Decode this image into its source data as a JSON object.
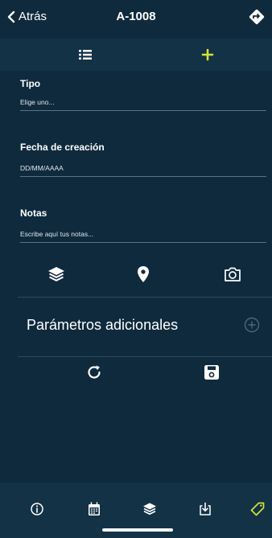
{
  "header": {
    "back_label": "Atrás",
    "title": "A-1008"
  },
  "subtabs": {
    "list_icon": "list-icon",
    "add_icon": "plus-icon"
  },
  "form": {
    "tipo": {
      "label": "Tipo",
      "placeholder": "Elige uno..."
    },
    "fecha": {
      "label": "Fecha de creación",
      "placeholder": "DD/MM/AAAA"
    },
    "notas": {
      "label": "Notas",
      "placeholder": "Escribe aquí tus notas..."
    }
  },
  "icon_row": [
    "layers-icon",
    "location-pin-icon",
    "camera-icon"
  ],
  "params": {
    "label": "Parámetros adicionales"
  },
  "actions": [
    "refresh-icon",
    "save-icon"
  ],
  "bottom_nav": [
    "info-icon",
    "calendar-icon",
    "layers-icon",
    "download-icon",
    "tag-icon"
  ],
  "colors": {
    "background": "#0f2a3d",
    "accent": "#d4e23a",
    "text": "#ffffff"
  }
}
